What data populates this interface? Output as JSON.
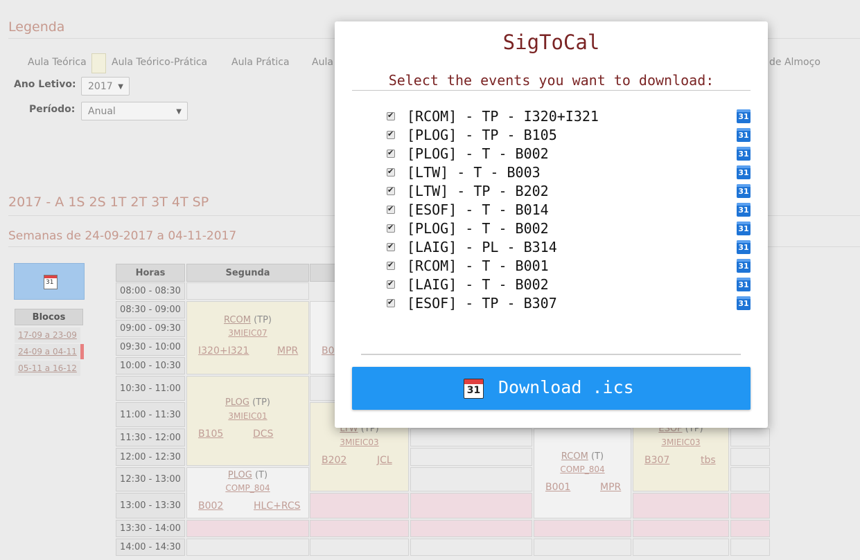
{
  "legend": {
    "title": "Legenda",
    "items": [
      "Aula Teórica",
      "Aula Teórico-Prática",
      "Aula Prática",
      "Aula",
      "de Almoço"
    ]
  },
  "form": {
    "ano_label": "Ano Letivo:",
    "ano_value": "2017",
    "periodo_label": "Período:",
    "periodo_value": "Anual"
  },
  "schedule": {
    "title": "2017 - A 1S 2S 1T 2T 3T 4T SP",
    "weeks_title": "Semanas de 24-09-2017 a 04-11-2017",
    "blocos_label": "Blocos",
    "blocos": [
      "17-09 a 23-09",
      "24-09 a 04-11",
      "05-11 a 16-12"
    ],
    "headers": [
      "Horas",
      "Segunda"
    ],
    "hours": [
      "08:00 - 08:30",
      "08:30 - 09:00",
      "09:00 - 09:30",
      "09:30 - 10:00",
      "10:00 - 10:30",
      "10:30 - 11:00",
      "11:00 - 11:30",
      "11:30 - 12:00",
      "12:00 - 12:30",
      "12:30 - 13:00",
      "13:00 - 13:30",
      "13:30 - 14:00",
      "14:00 - 14:30"
    ],
    "events": [
      {
        "code": "RCOM",
        "type": "(TP)",
        "class": "3MIEIC07",
        "room": "I320+I321",
        "prof": "MPR"
      },
      {
        "code": "PLOG",
        "type": "(TP)",
        "class": "3MIEIC01",
        "room": "B105",
        "prof": "DCS"
      },
      {
        "code": "PLOG",
        "type": "(T)",
        "class": "COMP_804",
        "room": "B002",
        "prof": "HLC+RCS"
      },
      {
        "code": "LTW",
        "type": "(TP)",
        "class": "3MIEIC03",
        "room": "B202",
        "prof": "JCL"
      },
      {
        "code": "RCOM",
        "type": "(T)",
        "class": "COMP_804",
        "room": "B001",
        "prof": "MPR"
      },
      {
        "code": "ESOF",
        "type": "(TP)",
        "class": "3MIEIC03",
        "room": "B307",
        "prof": "tbs"
      },
      {
        "room_partial": "B0"
      }
    ]
  },
  "modal": {
    "title": "SigToCal",
    "subtitle": "Select the events you want to download:",
    "events": [
      "[RCOM] - TP - I320+I321",
      "[PLOG] - TP - B105",
      "[PLOG] - T - B002",
      "[LTW] - T - B003",
      "[LTW] - TP - B202",
      "[ESOF] - T - B014",
      "[PLOG] - T - B002",
      "[LAIG] - PL - B314",
      "[RCOM] - T - B001",
      "[LAIG] - T - B002",
      "[ESOF] - TP - B307"
    ],
    "gcal_icon_text": "31",
    "download_label": "Download .ics",
    "download_icon_text": "31"
  },
  "colors": {
    "accent": "#2196f3",
    "title_red": "#7a2424",
    "link": "#c19d96",
    "tp_cell": "#f1eedc",
    "lunch_cell": "#f0dbe1"
  },
  "icons": [
    "calendar-icon",
    "google-calendar-icon",
    "checkbox-icon"
  ]
}
